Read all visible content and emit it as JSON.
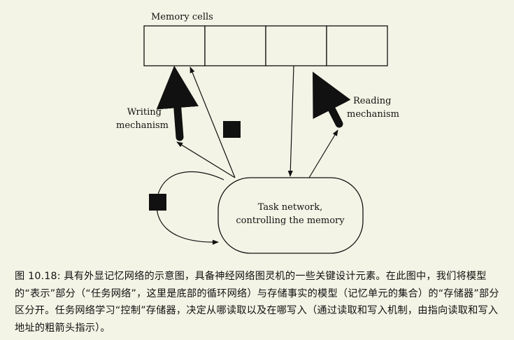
{
  "diagram": {
    "memory_label": "Memory cells",
    "writing_label_line1": "Writing",
    "writing_label_line2": "mechanism",
    "reading_label_line1": "Reading",
    "reading_label_line2": "mechanism",
    "task_line1": "Task network,",
    "task_line2": "controlling the memory"
  },
  "caption": {
    "text": "图 10.18: 具有外显记忆网络的示意图，具备神经网络图灵机的一些关键设计元素。在此图中，我们将模型的“表示”部分（“任务网络”，这里是底部的循环网络）与存储事实的模型（记忆单元的集合）的“存储器”部分区分开。任务网络学习“控制”存储器，决定从哪读取以及在哪写入（通过读取和写入机制，由指向读取和写入地址的粗箭头指示）。"
  }
}
